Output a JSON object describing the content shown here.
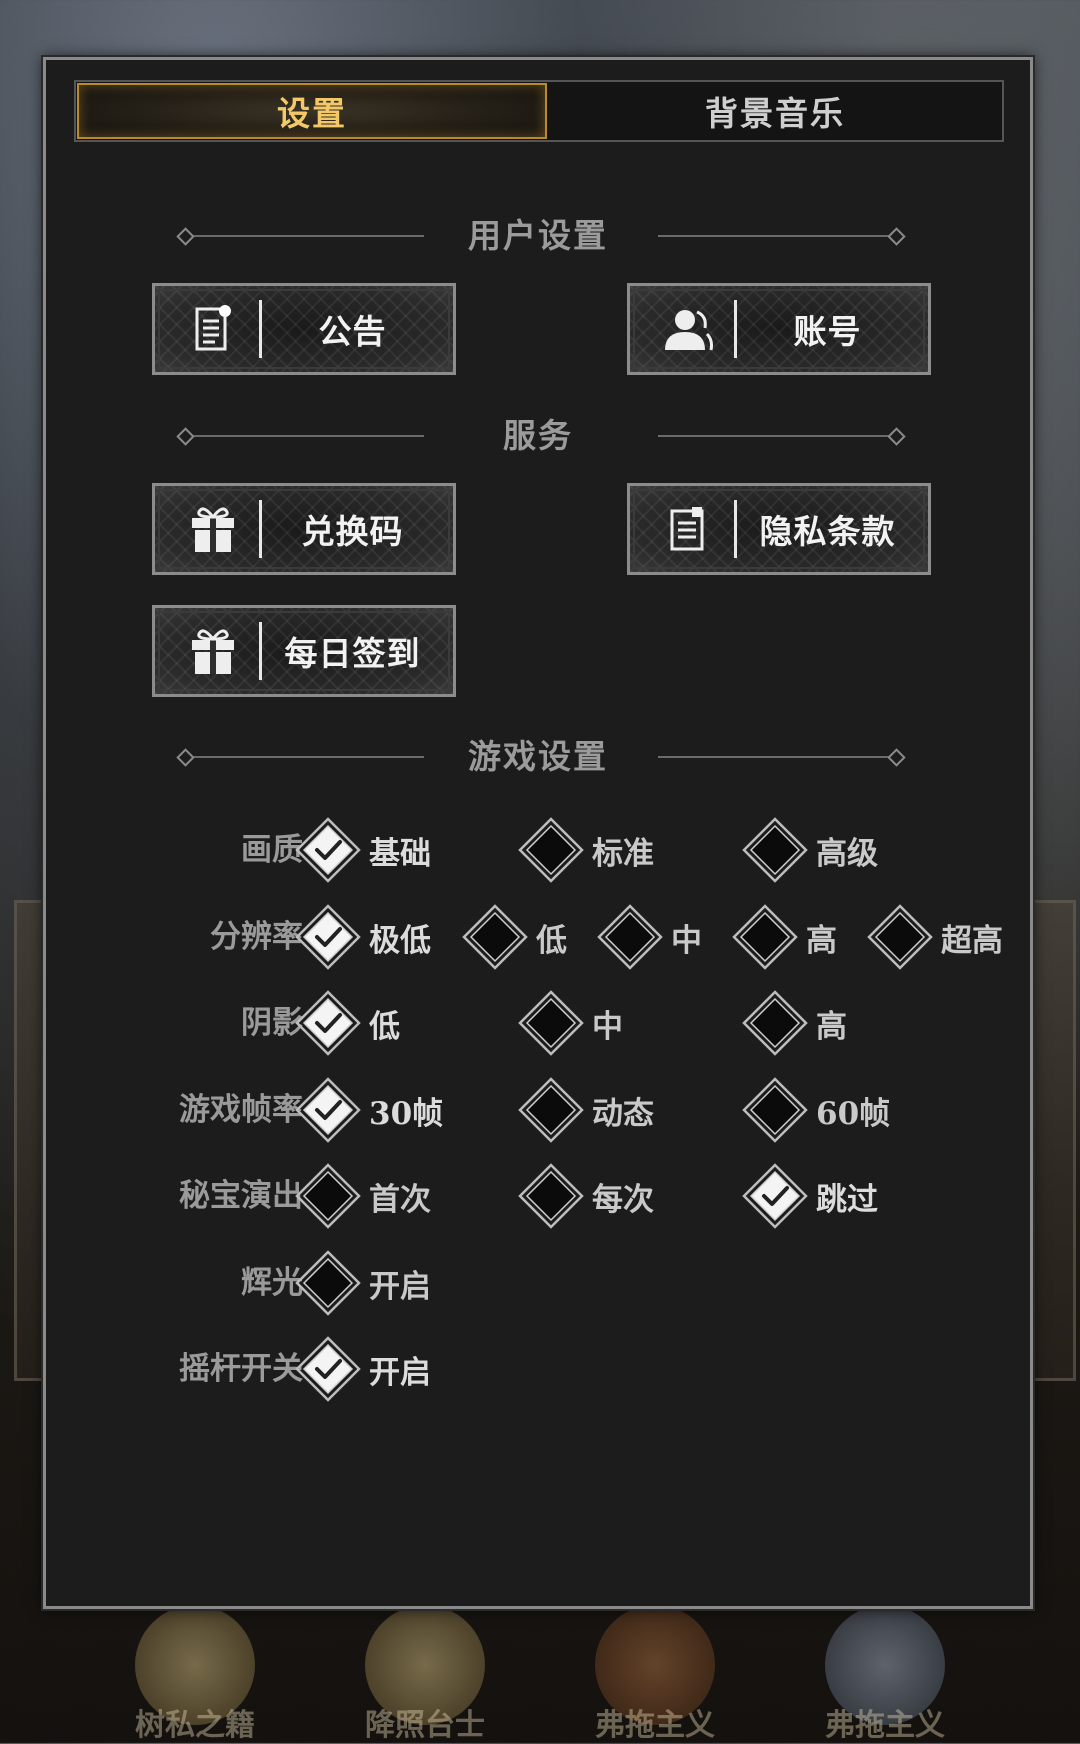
{
  "tabs": [
    {
      "label": "设置",
      "active": true
    },
    {
      "label": "背景音乐",
      "active": false
    }
  ],
  "sections": {
    "user": "用户设置",
    "service": "服务",
    "game": "游戏设置"
  },
  "buttons": {
    "notice": {
      "label": "公告",
      "icon": "document-icon"
    },
    "account": {
      "label": "账号",
      "icon": "user-icon"
    },
    "redeem": {
      "label": "兑换码",
      "icon": "gift-icon"
    },
    "privacy": {
      "label": "隐私条款",
      "icon": "document-lock-icon"
    },
    "checkin": {
      "label": "每日签到",
      "icon": "gift-icon"
    }
  },
  "settings": [
    {
      "label": "画质",
      "options": [
        {
          "text": "基础",
          "checked": true
        },
        {
          "text": "标准",
          "checked": false
        },
        {
          "text": "高级",
          "checked": false
        }
      ]
    },
    {
      "label": "分辨率",
      "options": [
        {
          "text": "极低",
          "checked": true
        },
        {
          "text": "低",
          "checked": false
        },
        {
          "text": "中",
          "checked": false
        },
        {
          "text": "高",
          "checked": false
        },
        {
          "text": "超高",
          "checked": false
        }
      ]
    },
    {
      "label": "阴影",
      "options": [
        {
          "text": "低",
          "checked": true
        },
        {
          "text": "中",
          "checked": false
        },
        {
          "text": "高",
          "checked": false
        }
      ]
    },
    {
      "label": "游戏帧率",
      "options": [
        {
          "text": "30帧",
          "checked": true
        },
        {
          "text": "动态",
          "checked": false
        },
        {
          "text": "60帧",
          "checked": false
        }
      ]
    },
    {
      "label": "秘宝演出",
      "options": [
        {
          "text": "首次",
          "checked": false
        },
        {
          "text": "每次",
          "checked": false
        },
        {
          "text": "跳过",
          "checked": true
        }
      ]
    },
    {
      "label": "辉光",
      "options": [
        {
          "text": "开启",
          "checked": false
        }
      ]
    },
    {
      "label": "摇杆开关",
      "options": [
        {
          "text": "开启",
          "checked": true
        }
      ]
    }
  ],
  "background": {
    "emblem_labels": [
      "树私之籍",
      "降照台士",
      "弗拖主义",
      "弗拖主义"
    ]
  },
  "colors": {
    "panel": "#1c1c1c",
    "tab_active_text": "#f3c869",
    "tab_active_border": "#b98a2e",
    "label_gray": "#9a9a9a",
    "checked_fill": "#f4f4f4"
  }
}
